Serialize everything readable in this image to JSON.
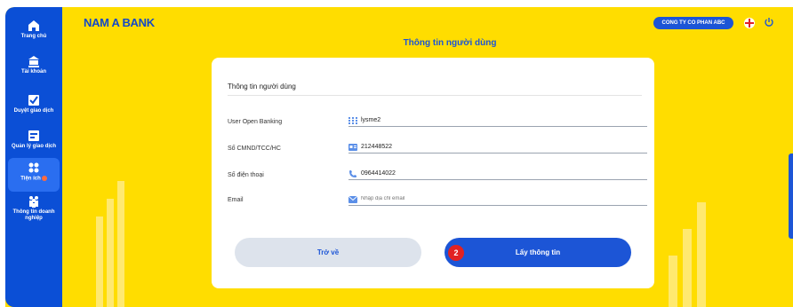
{
  "colors": {
    "brand_yellow": "#ffdd00",
    "brand_blue": "#1c55d6",
    "sidebar_blue": "#0b4fd6",
    "step_badge_red": "#e22222"
  },
  "sidebar": {
    "items": [
      {
        "label": "Trang chủ",
        "icon": "home-icon",
        "active": false
      },
      {
        "label": "Tài khoản",
        "icon": "bank-icon",
        "active": false
      },
      {
        "label": "Duyệt giao dịch",
        "icon": "check-icon",
        "active": false
      },
      {
        "label": "Quản lý giao dịch",
        "icon": "manage-icon",
        "active": false
      },
      {
        "label": "Tiện ích",
        "icon": "grid-icon",
        "active": true,
        "has_dot": true
      },
      {
        "label": "Thông tin doanh",
        "label2": "nghiệp",
        "icon": "people-icon",
        "active": false
      }
    ]
  },
  "header": {
    "logo": "NAM A BANK",
    "page_title": "Thông tin người dùng",
    "company": "CONG TY CO PHAN ABC",
    "language_icon": "flag-icon",
    "logout_icon": "power-icon"
  },
  "form": {
    "section_title": "Thông tin người dùng",
    "rows": [
      {
        "label": "User Open Banking",
        "value": "lysme2",
        "icon": "user-grid-icon"
      },
      {
        "label": "Số CMND/TCC/HC",
        "value": "212448522",
        "icon": "id-card-icon"
      },
      {
        "label": "Số điện thoại",
        "value": "0964414022",
        "icon": "phone-icon"
      },
      {
        "label": "Email",
        "value": "",
        "placeholder": "Nhập địa chỉ email",
        "icon": "mail-icon"
      }
    ],
    "back_label": "Trở về",
    "submit_label": "Lấy thông tin",
    "step_badge": "2"
  }
}
